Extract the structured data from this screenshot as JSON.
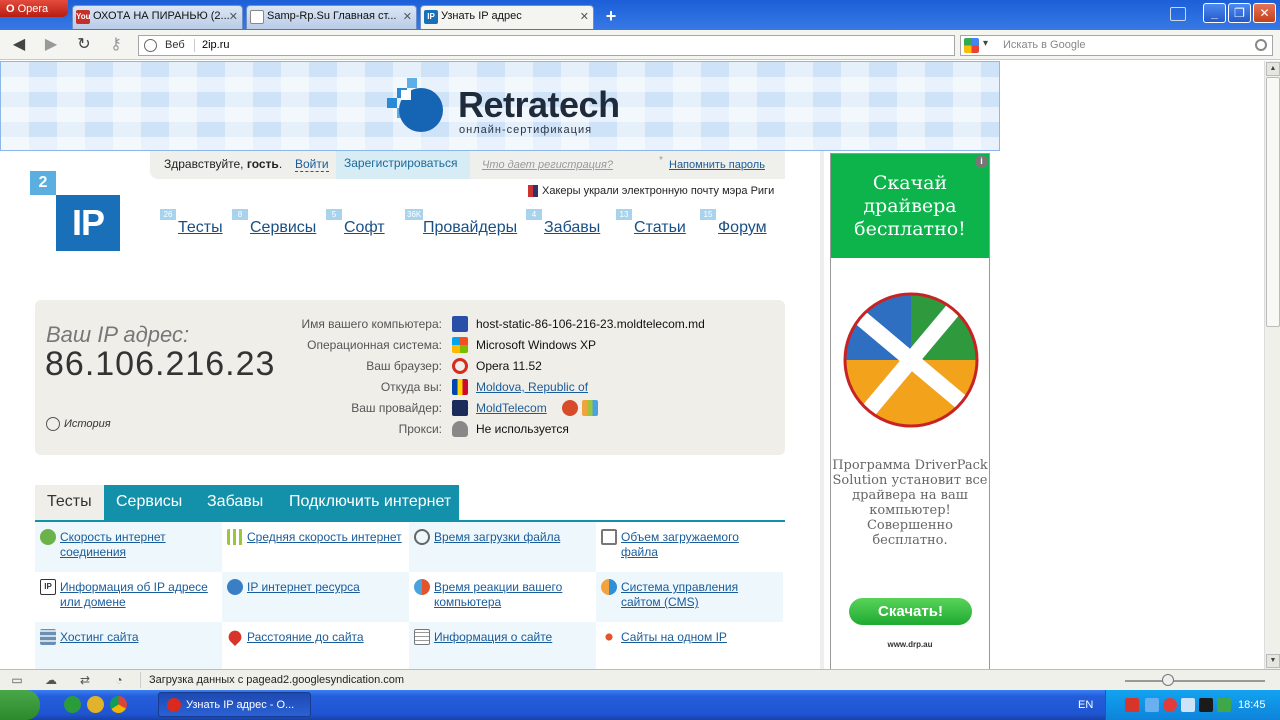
{
  "browser": {
    "menu_label": "Opera",
    "tabs": [
      {
        "title": "ОХОТА НА ПИРАНЬЮ (2...",
        "favicon": "youtube-icon"
      },
      {
        "title": "Samp-Rp.Su Главная ст...",
        "favicon": "page-icon"
      },
      {
        "title": "Узнать IP адрес",
        "favicon": "2ip-icon"
      }
    ],
    "address": {
      "prefix": "Веб",
      "url": "2ip.ru"
    },
    "search": {
      "placeholder": "Искать в Google",
      "engine": "google-icon"
    }
  },
  "banner": {
    "brand": "Retratech",
    "tagline": "онлайн-сертификация"
  },
  "header": {
    "greeting_prefix": "Здравствуйте, ",
    "greeting_user": "гость",
    "greeting_suffix": ".",
    "login": "Войти",
    "register": "Зарегистрироваться",
    "why_register": "Что дает регистрация?",
    "remind_star": "*",
    "remind_password": "Напомнить пароль",
    "news": "Хакеры украли электронную почту мэра Риги"
  },
  "logo": {
    "two": "2",
    "ip": "IP"
  },
  "nav": [
    {
      "label": "Тесты",
      "count": "26"
    },
    {
      "label": "Сервисы",
      "count": "8"
    },
    {
      "label": "Софт",
      "count": "5"
    },
    {
      "label": "Провайдеры",
      "count": "36K"
    },
    {
      "label": "Забавы",
      "count": "4"
    },
    {
      "label": "Статьи",
      "count": "13"
    },
    {
      "label": "Форум",
      "count": "15"
    }
  ],
  "ip_panel": {
    "caption": "Ваш IP адрес:",
    "ip": "86.106.216.23",
    "history": "История",
    "rows": [
      {
        "label": "Имя вашего компьютера:",
        "value": "host-static-86-106-216-23.moldtelecom.md",
        "icon": "computer-icon",
        "link": false
      },
      {
        "label": "Операционная система:",
        "value": "Microsoft Windows XP",
        "icon": "windows-icon",
        "link": false
      },
      {
        "label": "Ваш браузер:",
        "value": "Opera 11.52",
        "icon": "opera-icon",
        "link": false
      },
      {
        "label": "Откуда вы:",
        "value": "Moldova, Republic of",
        "icon": "moldova-flag-icon",
        "link": true
      },
      {
        "label": "Ваш провайдер:",
        "value": "MoldTelecom",
        "icon": "moldtelecom-icon",
        "link": true
      },
      {
        "label": "Прокси:",
        "value": "Не используется",
        "icon": "glasses-icon",
        "link": false
      }
    ]
  },
  "section_tabs": [
    "Тесты",
    "Сервисы",
    "Забавы",
    "Подключить интернет"
  ],
  "tests": [
    {
      "text": "Скорость интернет соединения",
      "icon": "speed-arrow-icon"
    },
    {
      "text": "Средняя скорость интернет",
      "icon": "bars-icon"
    },
    {
      "text": "Время загрузки файла",
      "icon": "clock-icon"
    },
    {
      "text": "Объем загружаемого файла",
      "icon": "file-size-icon"
    },
    {
      "text": "Информация об IP адресе или домене",
      "icon": "ip-icon"
    },
    {
      "text": "IP интернет ресурса",
      "icon": "globe-ip-icon"
    },
    {
      "text": "Время реакции вашего компьютера",
      "icon": "reaction-icon"
    },
    {
      "text": "Система управления сайтом (CMS)",
      "icon": "cms-icon"
    },
    {
      "text": "Хостинг сайта",
      "icon": "server-icon"
    },
    {
      "text": "Расстояние до сайта",
      "icon": "map-pin-icon"
    },
    {
      "text": "Информация о сайте",
      "icon": "document-icon"
    },
    {
      "text": "Сайты на одном IP",
      "icon": "network-icon"
    }
  ],
  "ad": {
    "headline": "Скачай драйвера бесплатно!",
    "body": "Программа DriverPack Solution установит все драйвера на ваш компьютер! Совершенно бесплатно.",
    "cta": "Скачать!",
    "site": "www.drp.au",
    "info": "i"
  },
  "status": {
    "message": "Загрузка данных с pagead2.googlesyndication.com"
  },
  "taskbar": {
    "task_title": "Узнать IP адрес - O...",
    "lang": "EN",
    "time": "18:45"
  }
}
